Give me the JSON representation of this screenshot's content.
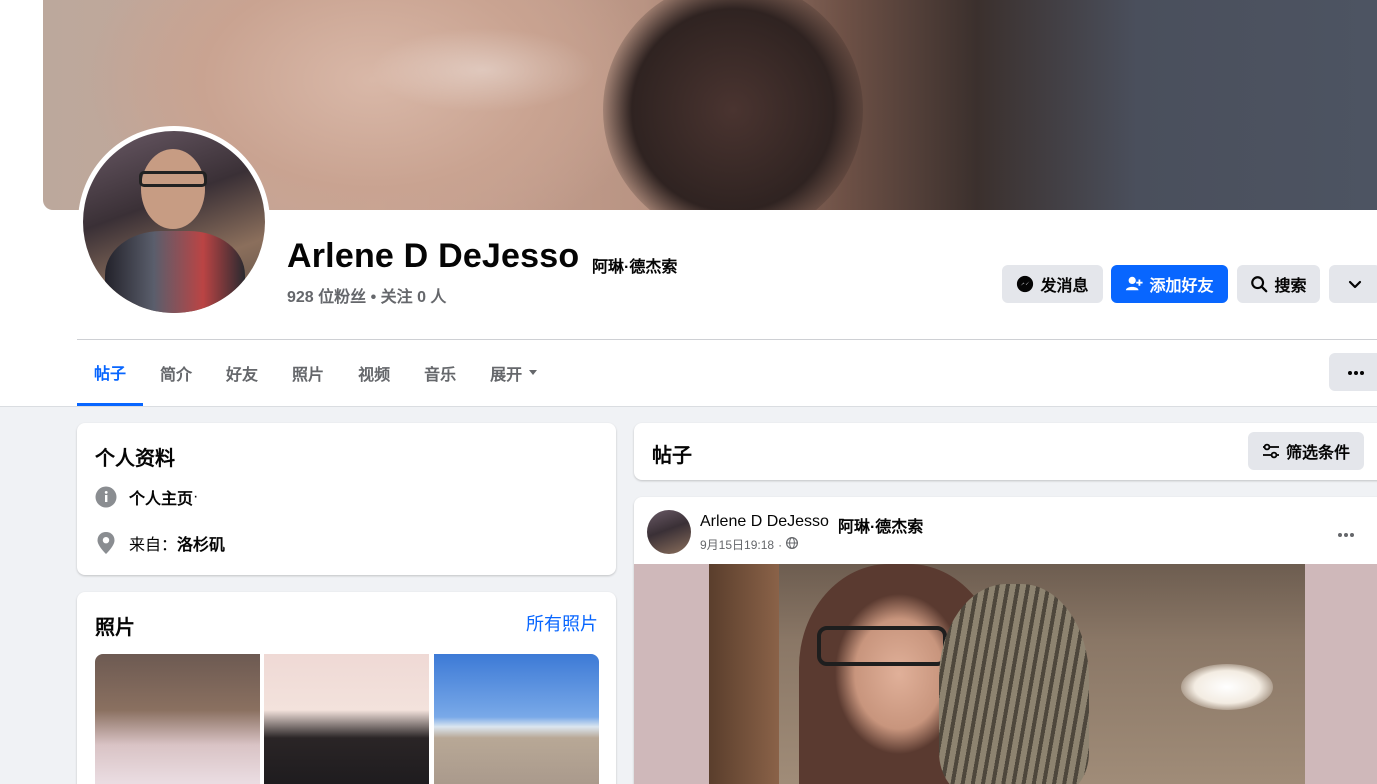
{
  "profile": {
    "name": "Arlene D DeJesso",
    "alt_name": "阿琳·德杰索",
    "stats": "928 位粉丝 • 关注 0 人"
  },
  "actions": {
    "message": "发消息",
    "add_friend": "添加好友",
    "search": "搜索"
  },
  "tabs": [
    {
      "label": "帖子",
      "active": true
    },
    {
      "label": "简介"
    },
    {
      "label": "好友"
    },
    {
      "label": "照片"
    },
    {
      "label": "视频"
    },
    {
      "label": "音乐"
    },
    {
      "label": "展开"
    }
  ],
  "intro": {
    "title": "个人资料",
    "page_label": "个人主页",
    "page_suffix": " ·",
    "from_label": "来自：",
    "from_value": "洛杉矶"
  },
  "photos": {
    "title": "照片",
    "all_link": "所有照片"
  },
  "posts_header": {
    "title": "帖子",
    "filter": "筛选条件"
  },
  "post": {
    "author": "Arlene D DeJesso",
    "author_alt": "阿琳·德杰索",
    "time": "9月15日19:18",
    "separator": "·"
  },
  "colors": {
    "accent": "#0866ff",
    "secondary_button": "#e4e6eb",
    "page_bg": "#f0f2f5",
    "muted_text": "#65676b"
  }
}
